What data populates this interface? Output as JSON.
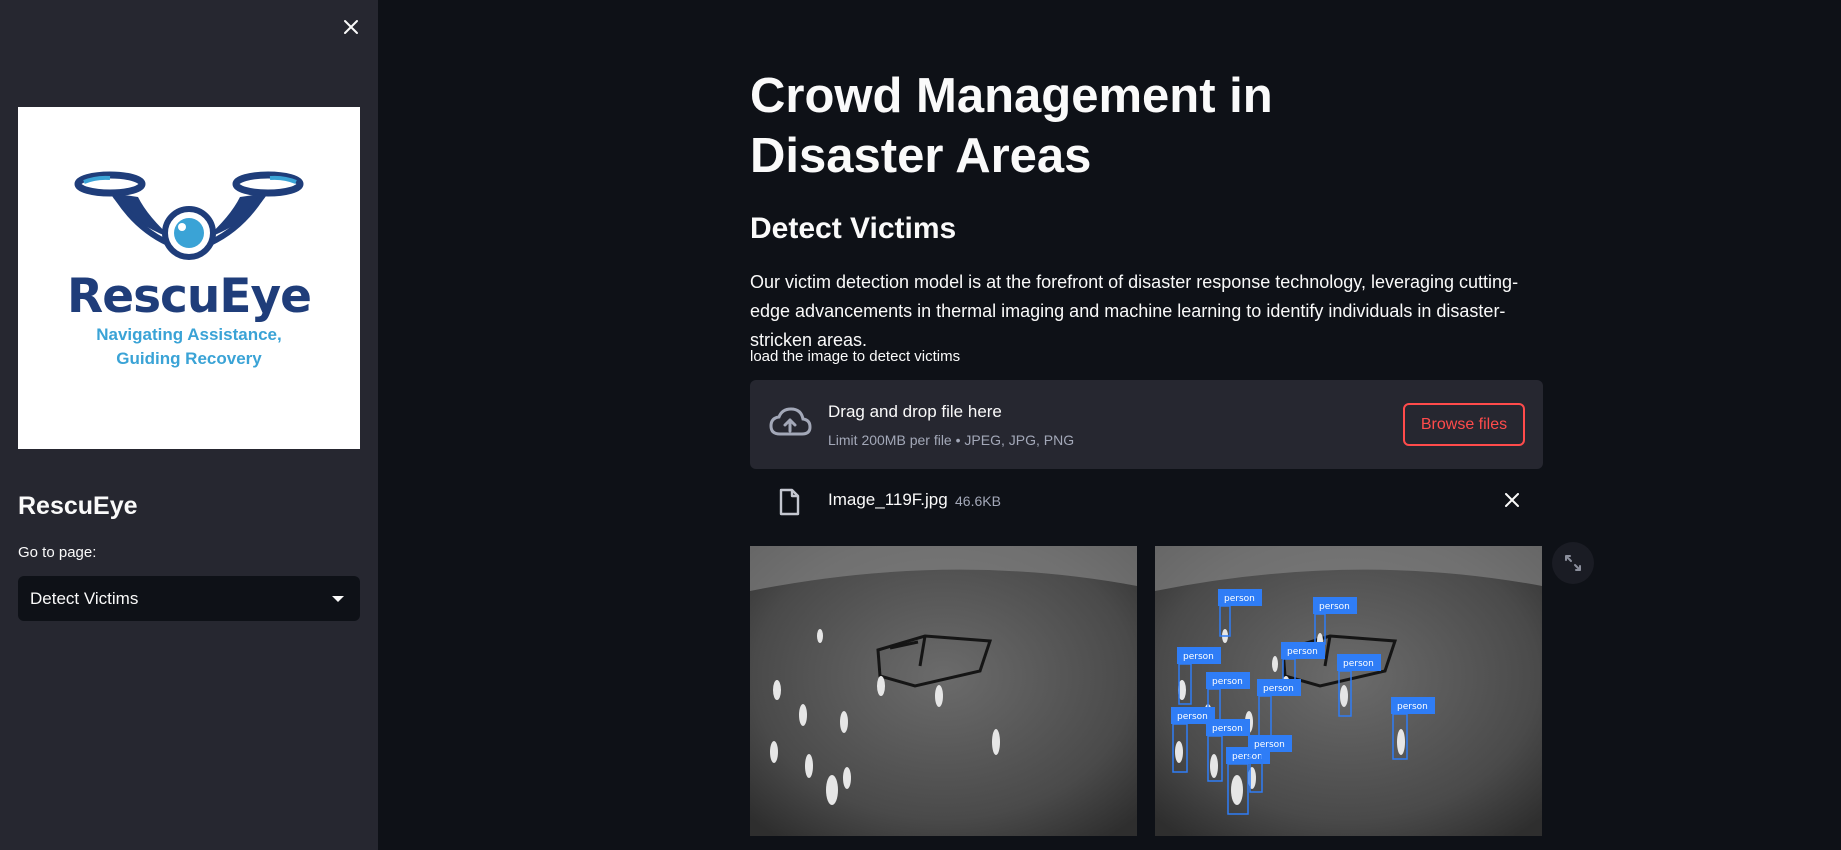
{
  "sidebar": {
    "logo": {
      "brand": "RescuEye",
      "tagline_line1": "Navigating Assistance,",
      "tagline_line2": "Guiding Recovery"
    },
    "title": "RescuEye",
    "nav_label": "Go to page:",
    "nav_selected": "Detect Victims"
  },
  "main": {
    "title": "Crowd Management in Disaster Areas",
    "subtitle": "Detect Victims",
    "description": "Our victim detection model is at the forefront of disaster response technology, leveraging cutting-edge advancements in thermal imaging and machine learning to identify individuals in disaster-stricken areas.",
    "uploader": {
      "label": "load the image to detect victims",
      "drop_text": "Drag and drop file here",
      "limit_text": "Limit 200MB per file • JPEG, JPG, PNG",
      "browse_label": "Browse files"
    },
    "uploaded_file": {
      "name": "Image_119F.jpg",
      "size": "46.6KB"
    },
    "detection_label": "person"
  },
  "colors": {
    "app_bg": "#0e1117",
    "sidebar_bg": "#262730",
    "accent": "#ff4b4b",
    "detection_box": "#2f7df6",
    "logo_navy": "#1f3d7a",
    "logo_blue": "#3aa3d6"
  },
  "icons": [
    "close-icon",
    "chevron-down-icon",
    "cloud-upload-icon",
    "file-icon",
    "close-icon",
    "fullscreen-icon"
  ]
}
